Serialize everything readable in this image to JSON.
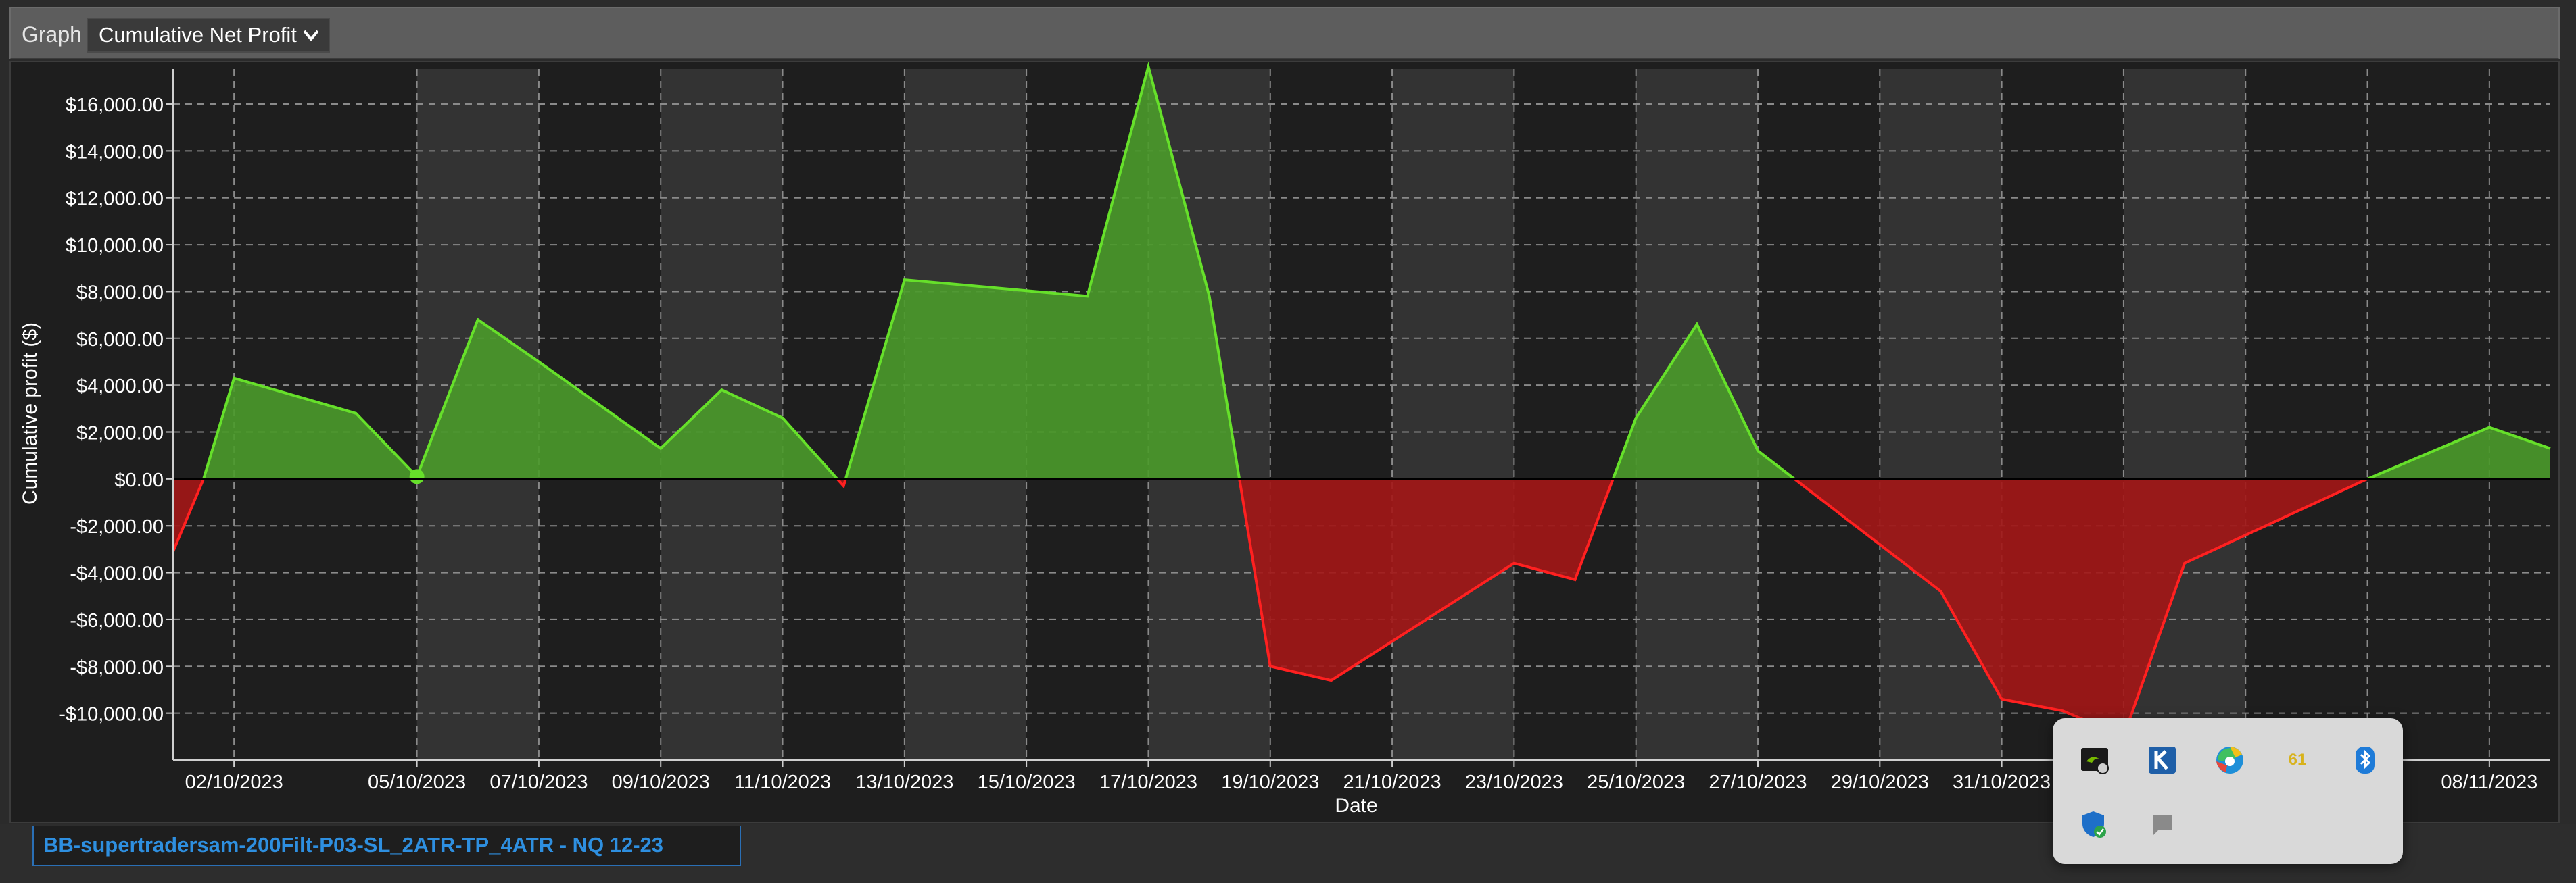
{
  "toolbar": {
    "graph_label": "Graph",
    "selected_graph": "Cumulative Net Profit"
  },
  "chart_data": {
    "type": "area",
    "xlabel": "Date",
    "ylabel": "Cumulative profit ($)",
    "ylim": [
      -12000,
      17500
    ],
    "yticks": [
      -10000,
      -8000,
      -6000,
      -4000,
      -2000,
      0,
      2000,
      4000,
      6000,
      8000,
      10000,
      12000,
      14000,
      16000
    ],
    "ytick_labels": [
      "-$10,000.00",
      "-$8,000.00",
      "-$6,000.00",
      "-$4,000.00",
      "-$2,000.00",
      "$0.00",
      "$2,000.00",
      "$4,000.00",
      "$6,000.00",
      "$8,000.00",
      "$10,000.00",
      "$12,000.00",
      "$14,000.00",
      "$16,000.00"
    ],
    "xlim": [
      "2023-10-01",
      "2023-11-09"
    ],
    "xtick_labels": [
      {
        "date": "2023-10-02",
        "label": "02/10/2023"
      },
      {
        "date": "2023-10-05",
        "label": "05/10/2023"
      },
      {
        "date": "2023-10-07",
        "label": "07/10/2023"
      },
      {
        "date": "2023-10-09",
        "label": "09/10/2023"
      },
      {
        "date": "2023-10-11",
        "label": "11/10/2023"
      },
      {
        "date": "2023-10-13",
        "label": "13/10/2023"
      },
      {
        "date": "2023-10-15",
        "label": "15/10/2023"
      },
      {
        "date": "2023-10-17",
        "label": "17/10/2023"
      },
      {
        "date": "2023-10-19",
        "label": "19/10/2023"
      },
      {
        "date": "2023-10-21",
        "label": "21/10/2023"
      },
      {
        "date": "2023-10-23",
        "label": "23/10/2023"
      },
      {
        "date": "2023-10-25",
        "label": "25/10/2023"
      },
      {
        "date": "2023-10-27",
        "label": "27/10/2023"
      },
      {
        "date": "2023-10-29",
        "label": "29/10/2023"
      },
      {
        "date": "2023-10-31",
        "label": "31/10/2023"
      },
      {
        "date": "2023-11-08",
        "label": "08/11/2023"
      }
    ],
    "grid": true,
    "shaded_bands": [
      [
        "2023-10-05",
        "2023-10-07"
      ],
      [
        "2023-10-09",
        "2023-10-11"
      ],
      [
        "2023-10-13",
        "2023-10-15"
      ],
      [
        "2023-10-17",
        "2023-10-19"
      ],
      [
        "2023-10-21",
        "2023-10-23"
      ],
      [
        "2023-10-25",
        "2023-10-27"
      ],
      [
        "2023-10-29",
        "2023-10-31"
      ],
      [
        "2023-11-02",
        "2023-11-04"
      ]
    ],
    "series": [
      {
        "points": [
          [
            "2023-10-01",
            -3100
          ],
          [
            "2023-10-01 12:00",
            0
          ],
          [
            "2023-10-02",
            4300
          ],
          [
            "2023-10-04",
            2800
          ],
          [
            "2023-10-05",
            100
          ],
          [
            "2023-10-06",
            6800
          ],
          [
            "2023-10-07",
            5000
          ],
          [
            "2023-10-09",
            1300
          ],
          [
            "2023-10-10",
            3800
          ],
          [
            "2023-10-11",
            2600
          ],
          [
            "2023-10-12",
            -300
          ],
          [
            "2023-10-13",
            8500
          ],
          [
            "2023-10-16",
            7800
          ],
          [
            "2023-10-17",
            17600
          ],
          [
            "2023-10-18",
            7800
          ],
          [
            "2023-10-19",
            -8000
          ],
          [
            "2023-10-20",
            -8600
          ],
          [
            "2023-10-23",
            -3600
          ],
          [
            "2023-10-24",
            -4300
          ],
          [
            "2023-10-25",
            2600
          ],
          [
            "2023-10-26",
            6600
          ],
          [
            "2023-10-27",
            1200
          ],
          [
            "2023-10-30",
            -4800
          ],
          [
            "2023-10-31",
            -9400
          ],
          [
            "2023-11-01",
            -9900
          ],
          [
            "2023-11-02",
            -11000
          ],
          [
            "2023-11-03",
            -3600
          ],
          [
            "2023-11-06",
            0
          ],
          [
            "2023-11-08",
            2200
          ],
          [
            "2023-11-09",
            1300
          ]
        ]
      }
    ],
    "marker_point": [
      "2023-10-05",
      100
    ],
    "colors": {
      "positive_line": "#66e02a",
      "positive_fill": "#4a9a2a",
      "negative_line": "#ff2020",
      "negative_fill": "#a31616",
      "band": "#333333",
      "background": "#1e1e1e",
      "grid": "#8a8a8a",
      "text": "#ffffff"
    }
  },
  "tabs": {
    "strategy_tab": "BB-supertradersam-200Filt-P03-SL_2ATR-TP_4ATR - NQ 12-23"
  },
  "tray": {
    "icons": [
      "nvidia-icon",
      "k-app-icon",
      "edge-icon",
      "notification-count-icon",
      "bluetooth-icon",
      "windows-security-icon",
      "message-icon"
    ],
    "badge_count": "61"
  }
}
